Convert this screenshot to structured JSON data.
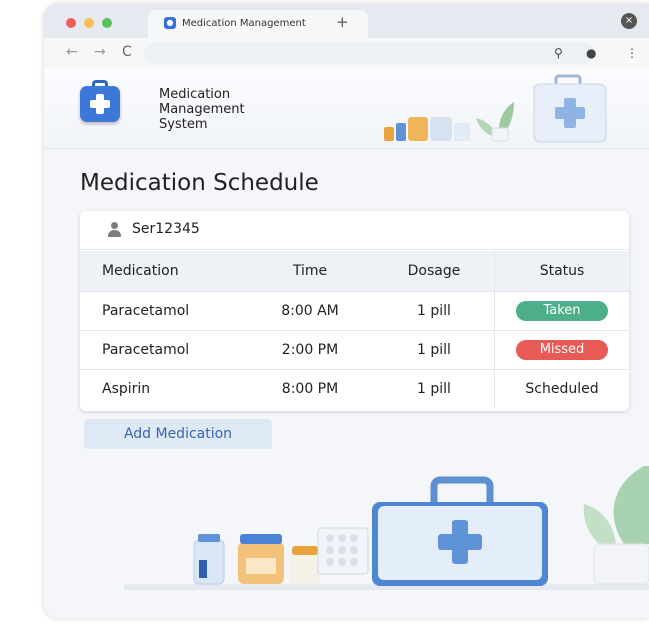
{
  "browser": {
    "tab_title": "Medication Management",
    "new_tab": "+",
    "back": "←",
    "forward": "→",
    "reload": "C",
    "close": "×",
    "toolbar_icons": [
      "search-icon",
      "microphone-icon",
      "menu-icon"
    ]
  },
  "app": {
    "title": "Medication\nManagement\nSystem",
    "colors": {
      "brand": "#3b78d8",
      "taken": "#4caf8a",
      "missed": "#e85a55",
      "button_bg": "#dfe8f5"
    }
  },
  "page": {
    "title": "Medication Schedule"
  },
  "user": {
    "id": "Ser12345"
  },
  "table": {
    "headers": [
      "Medication",
      "Time",
      "Dosage",
      "Status"
    ],
    "rows": [
      {
        "medication": "Paracetamol",
        "time": "8:00 AM",
        "dosage": "1 pill",
        "status": "Taken"
      },
      {
        "medication": "Paracetamol",
        "time": "2:00 PM",
        "dosage": "1 pill",
        "status": "Missed"
      },
      {
        "medication": "Aspirin",
        "time": "8:00 PM",
        "dosage": "1 pill",
        "status": "Scheduled"
      }
    ]
  },
  "actions": {
    "add_label": "Add Medication"
  }
}
